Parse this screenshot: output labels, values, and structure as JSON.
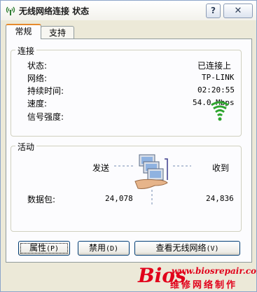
{
  "window": {
    "title": "无线网络连接 状态",
    "help_glyph": "?",
    "close_glyph": "✕"
  },
  "tabs": [
    {
      "label": "常规",
      "active": true
    },
    {
      "label": "支持",
      "active": false
    }
  ],
  "connection": {
    "legend": "连接",
    "rows": [
      {
        "label": "状态:",
        "value": "已连接上"
      },
      {
        "label": "网络:",
        "value": "TP-LINK"
      },
      {
        "label": "持续时间:",
        "value": "02:20:55"
      },
      {
        "label": "速度:",
        "value": "54.0 Mbps"
      },
      {
        "label": "信号强度:",
        "value": ""
      }
    ],
    "signal_icon": "signal-strength-icon",
    "signal_color": "#2EA52E"
  },
  "activity": {
    "legend": "活动",
    "sent_label": "发送",
    "received_label": "收到",
    "packets_label": "数据包:",
    "sent_packets": "24,078",
    "received_packets": "24,836",
    "icon": "network-activity-icon"
  },
  "buttons": {
    "properties": {
      "label": "属性",
      "mnemonic": "(P)"
    },
    "disable": {
      "label": "禁用",
      "mnemonic": "(D)"
    },
    "view": {
      "label": "查看无线网络",
      "mnemonic": "(V)"
    }
  },
  "watermark": {
    "brand": "Bios",
    "url": "www.biosrepair.com",
    "text": "维修网络制作",
    "color": "#E1001A"
  }
}
